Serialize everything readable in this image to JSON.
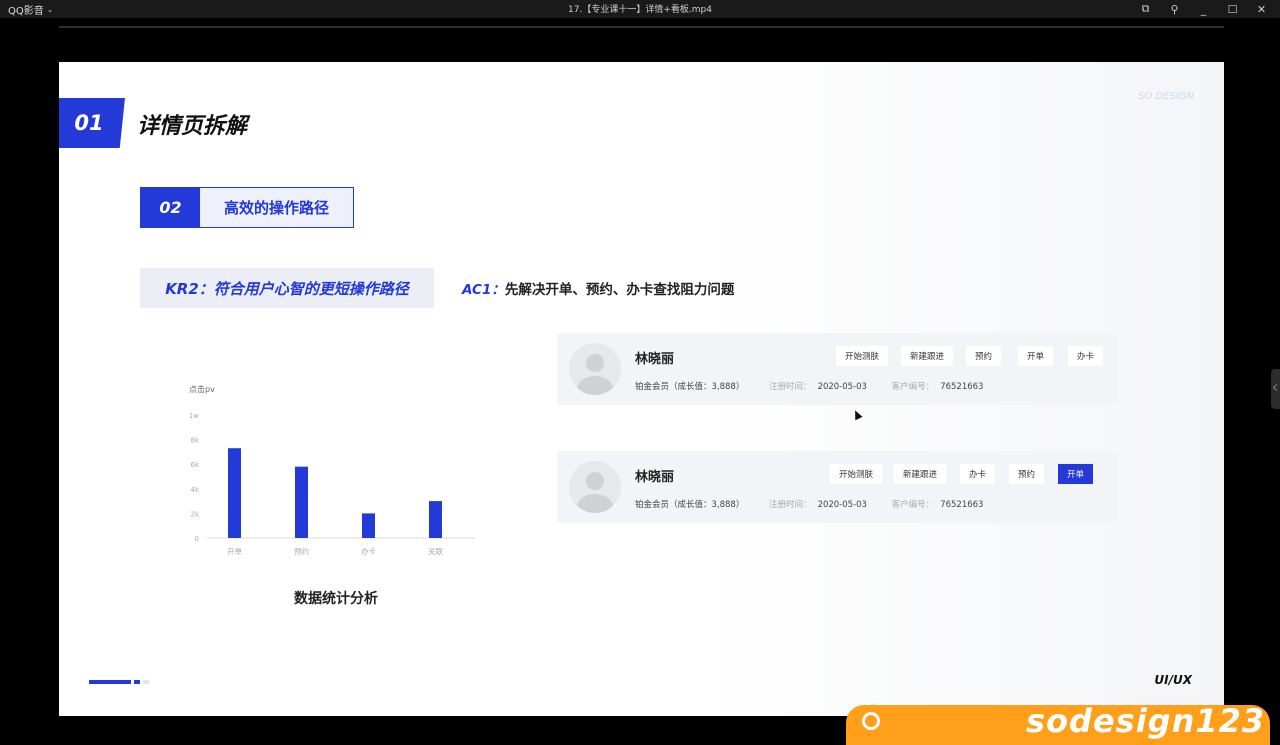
{
  "player": {
    "app_name": "QQ影音",
    "video_title": "17.【专业课十一】详情+看板.mp4",
    "controls": {
      "screenshot": "⧉",
      "pin": "⚲",
      "minimize": "_",
      "maximize": "☐",
      "close": "✕"
    }
  },
  "slide": {
    "section_number": "01",
    "section_title": "详情页拆解",
    "brand_mark": "SO DESIGN",
    "sub_number": "02",
    "sub_title": "高效的操作路径",
    "kr_text": "KR2：符合用户心智的更短操作路径",
    "ac_prefix": "AC1：",
    "ac_text": "先解决开单、预约、办卡查找阻力问题",
    "chart_caption": "数据统计分析",
    "footer_label": "UI/UX"
  },
  "chart_data": {
    "type": "bar",
    "ylabel": "点击pv",
    "categories": [
      "开单",
      "预约",
      "办卡",
      "关联"
    ],
    "values": [
      7300,
      5800,
      2000,
      3000
    ],
    "yticks": [
      "0",
      "2k",
      "4k",
      "6k",
      "8k",
      "1w"
    ],
    "ylim": [
      0,
      10000
    ],
    "bar_color": "#2339d8",
    "grid": false
  },
  "cards": [
    {
      "name": "林晓丽",
      "level": "铂金会员（成长值：3,888）",
      "reg_label": "注册时间：",
      "reg_date": "2020-05-03",
      "id_label": "客户编号：",
      "id_value": "76521663",
      "buttons": [
        {
          "label": "开始测肤",
          "primary": false
        },
        {
          "label": "新建跟进",
          "primary": false
        },
        {
          "label": "预约",
          "primary": false
        },
        {
          "label": "开单",
          "primary": false
        },
        {
          "label": "办卡",
          "primary": false
        }
      ]
    },
    {
      "name": "林晓丽",
      "level": "铂金会员（成长值：3,888）",
      "reg_label": "注册时间：",
      "reg_date": "2020-05-03",
      "id_label": "客户编号：",
      "id_value": "76521663",
      "buttons": [
        {
          "label": "开始测肤",
          "primary": false
        },
        {
          "label": "新建跟进",
          "primary": false
        },
        {
          "label": "办卡",
          "primary": false
        },
        {
          "label": "预约",
          "primary": false
        },
        {
          "label": "开单",
          "primary": true
        }
      ]
    }
  ],
  "watermark_text": "sodesign123"
}
